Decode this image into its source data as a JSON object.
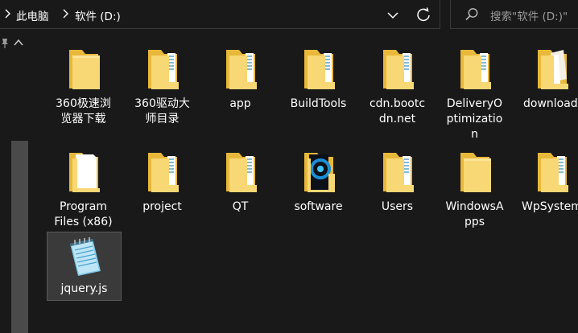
{
  "breadcrumb": {
    "root": "此电脑",
    "drive": "软件 (D:)"
  },
  "search": {
    "placeholder": "搜索\"软件 (D:)\""
  },
  "items": [
    {
      "name": "360极速浏览器下载",
      "line1": "360极速浏",
      "line2": "览器下载",
      "line3": "",
      "icon": "folder-icon"
    },
    {
      "name": "360驱动大师目录",
      "line1": "360驱动大",
      "line2": "师目录",
      "line3": "",
      "icon": "folder-with-files-icon"
    },
    {
      "name": "app",
      "line1": "app",
      "line2": "",
      "line3": "",
      "icon": "folder-with-files-icon"
    },
    {
      "name": "BuildTools",
      "line1": "BuildTools",
      "line2": "",
      "line3": "",
      "icon": "folder-with-files-icon"
    },
    {
      "name": "cdn.bootcdn.net",
      "line1": "cdn.bootc",
      "line2": "dn.net",
      "line3": "",
      "icon": "folder-with-files-icon"
    },
    {
      "name": "DeliveryOptimization",
      "line1": "DeliveryO",
      "line2": "ptimizatio",
      "line3": "n",
      "icon": "folder-with-files-icon"
    },
    {
      "name": "download",
      "line1": "download",
      "line2": "",
      "line3": "",
      "icon": "folder-with-documents-icon"
    },
    {
      "name": "Program Files (x86)",
      "line1": "Program",
      "line2": "Files (x86)",
      "line3": "",
      "icon": "folder-with-white-page-icon"
    },
    {
      "name": "project",
      "line1": "project",
      "line2": "",
      "line3": "",
      "icon": "folder-with-files-icon"
    },
    {
      "name": "QT",
      "line1": "QT",
      "line2": "",
      "line3": "",
      "icon": "folder-with-files-icon"
    },
    {
      "name": "software",
      "line1": "software",
      "line2": "",
      "line3": "",
      "icon": "folder-with-media-icon"
    },
    {
      "name": "Users",
      "line1": "Users",
      "line2": "",
      "line3": "",
      "icon": "folder-with-files-icon"
    },
    {
      "name": "WindowsApps",
      "line1": "WindowsA",
      "line2": "pps",
      "line3": "",
      "icon": "folder-icon"
    },
    {
      "name": "WpSystem",
      "line1": "WpSystem",
      "line2": "",
      "line3": "",
      "icon": "folder-with-files-icon"
    },
    {
      "name": "jquery.js",
      "line1": "jquery.js",
      "line2": "",
      "line3": "",
      "icon": "notepad-file-icon",
      "selected": true
    }
  ],
  "colors": {
    "background": "#191919",
    "folder_back": "#e8b83a",
    "folder_front": "#f8d775",
    "selection": "#3a3a3a"
  }
}
